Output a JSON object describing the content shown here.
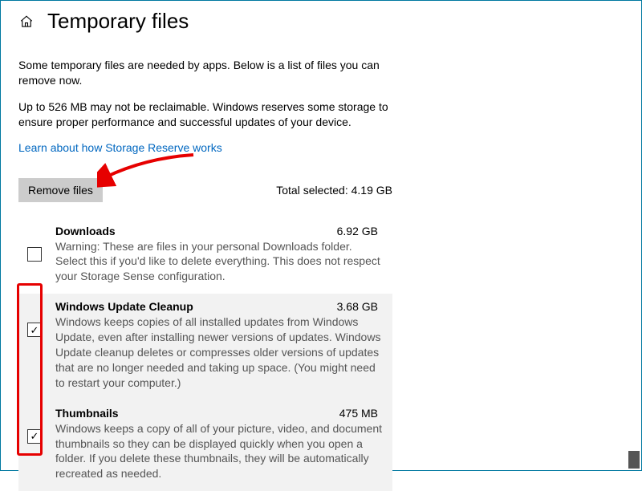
{
  "header": {
    "title": "Temporary files"
  },
  "intro": "Some temporary files are needed by apps. Below is a list of files you can remove now.",
  "reserve_note": "Up to 526 MB may not be reclaimable. Windows reserves some storage to ensure proper performance and successful updates of your device.",
  "link_text": "Learn about how Storage Reserve works",
  "remove_button": "Remove files",
  "total_selected_label": "Total selected: 4.19 GB",
  "items": [
    {
      "title": "Downloads",
      "size": "6.92 GB",
      "desc": "Warning: These are files in your personal Downloads folder. Select this if you'd like to delete everything. This does not respect your Storage Sense configuration.",
      "checked": false
    },
    {
      "title": "Windows Update Cleanup",
      "size": "3.68 GB",
      "desc": "Windows keeps copies of all installed updates from Windows Update, even after installing newer versions of updates. Windows Update cleanup deletes or compresses older versions of updates that are no longer needed and taking up space. (You might need to restart your computer.)",
      "checked": true
    },
    {
      "title": "Thumbnails",
      "size": "475 MB",
      "desc": "Windows keeps a copy of all of your picture, video, and document thumbnails so they can be displayed quickly when you open a folder. If you delete these thumbnails, they will be automatically recreated as needed.",
      "checked": true
    }
  ]
}
